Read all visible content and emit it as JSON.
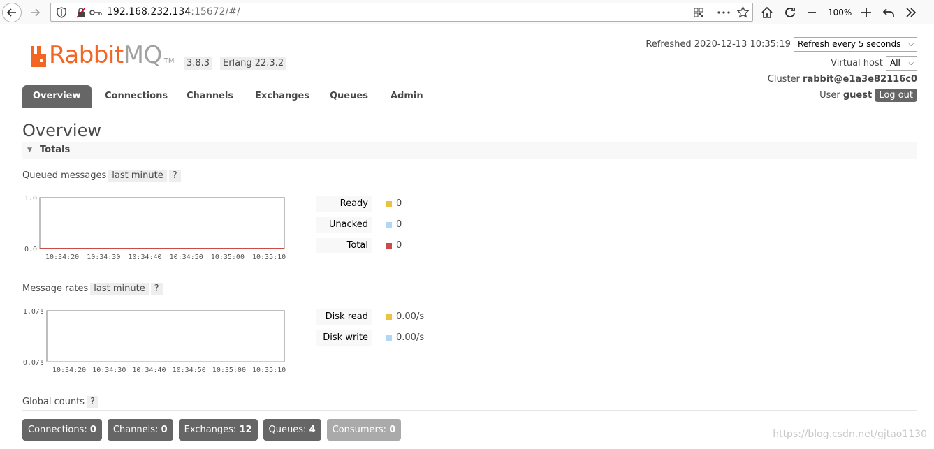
{
  "browser": {
    "url_host": "192.168.232.134",
    "url_rest": ":15672/#/",
    "zoom": "100%"
  },
  "header": {
    "logo_rabbit": "Rabbit",
    "logo_mq": "MQ",
    "logo_tm": "TM",
    "version": "3.8.3",
    "erlang": "Erlang 22.3.2",
    "refreshed_label": "Refreshed 2020-12-13 10:35:19",
    "refresh_select": "Refresh every 5 seconds",
    "vhost_label": "Virtual host",
    "vhost_select": "All",
    "cluster_label": "Cluster",
    "cluster_name": "rabbit@e1a3e82116c0",
    "user_label": "User",
    "user_name": "guest",
    "logout_label": "Log out"
  },
  "tabs": [
    {
      "label": "Overview"
    },
    {
      "label": "Connections"
    },
    {
      "label": "Channels"
    },
    {
      "label": "Exchanges"
    },
    {
      "label": "Queues"
    },
    {
      "label": "Admin"
    }
  ],
  "page": {
    "title": "Overview",
    "section": "Totals"
  },
  "queued": {
    "label": "Queued messages",
    "range": "last minute",
    "help": "?",
    "legend": [
      {
        "name": "Ready",
        "value": "0",
        "color": "#edc240"
      },
      {
        "name": "Unacked",
        "value": "0",
        "color": "#afd8f8"
      },
      {
        "name": "Total",
        "value": "0",
        "color": "#cb4b4b"
      }
    ]
  },
  "rates": {
    "label": "Message rates",
    "range": "last minute",
    "help": "?",
    "legend": [
      {
        "name": "Disk read",
        "value": "0.00/s",
        "color": "#edc240"
      },
      {
        "name": "Disk write",
        "value": "0.00/s",
        "color": "#afd8f8"
      }
    ]
  },
  "global": {
    "label": "Global counts",
    "help": "?",
    "counts": [
      {
        "label": "Connections:",
        "value": "0",
        "enabled": true
      },
      {
        "label": "Channels:",
        "value": "0",
        "enabled": true
      },
      {
        "label": "Exchanges:",
        "value": "12",
        "enabled": true
      },
      {
        "label": "Queues:",
        "value": "4",
        "enabled": true
      },
      {
        "label": "Consumers:",
        "value": "0",
        "enabled": false
      }
    ]
  },
  "watermark": "https://blog.csdn.net/gjtao1130",
  "chart_data": [
    {
      "type": "line",
      "x": [
        "10:34:20",
        "10:34:30",
        "10:34:40",
        "10:34:50",
        "10:35:00",
        "10:35:10"
      ],
      "ytick_labels": [
        "0.0",
        "1.0"
      ],
      "ylim": [
        0,
        1
      ],
      "series": [
        {
          "name": "Ready",
          "values": [
            0,
            0,
            0,
            0,
            0,
            0
          ],
          "color": "#edc240"
        },
        {
          "name": "Unacked",
          "values": [
            0,
            0,
            0,
            0,
            0,
            0
          ],
          "color": "#afd8f8"
        },
        {
          "name": "Total",
          "values": [
            0,
            0,
            0,
            0,
            0,
            0
          ],
          "color": "#cb4b4b"
        }
      ],
      "grid": false
    },
    {
      "type": "line",
      "x": [
        "10:34:20",
        "10:34:30",
        "10:34:40",
        "10:34:50",
        "10:35:00",
        "10:35:10"
      ],
      "ytick_labels": [
        "0.0/s",
        "1.0/s"
      ],
      "ylim": [
        0,
        1
      ],
      "series": [
        {
          "name": "Disk read",
          "values": [
            0,
            0,
            0,
            0,
            0,
            0
          ],
          "color": "#edc240"
        },
        {
          "name": "Disk write",
          "values": [
            0,
            0,
            0,
            0,
            0,
            0
          ],
          "color": "#afd8f8"
        }
      ],
      "grid": false
    }
  ]
}
